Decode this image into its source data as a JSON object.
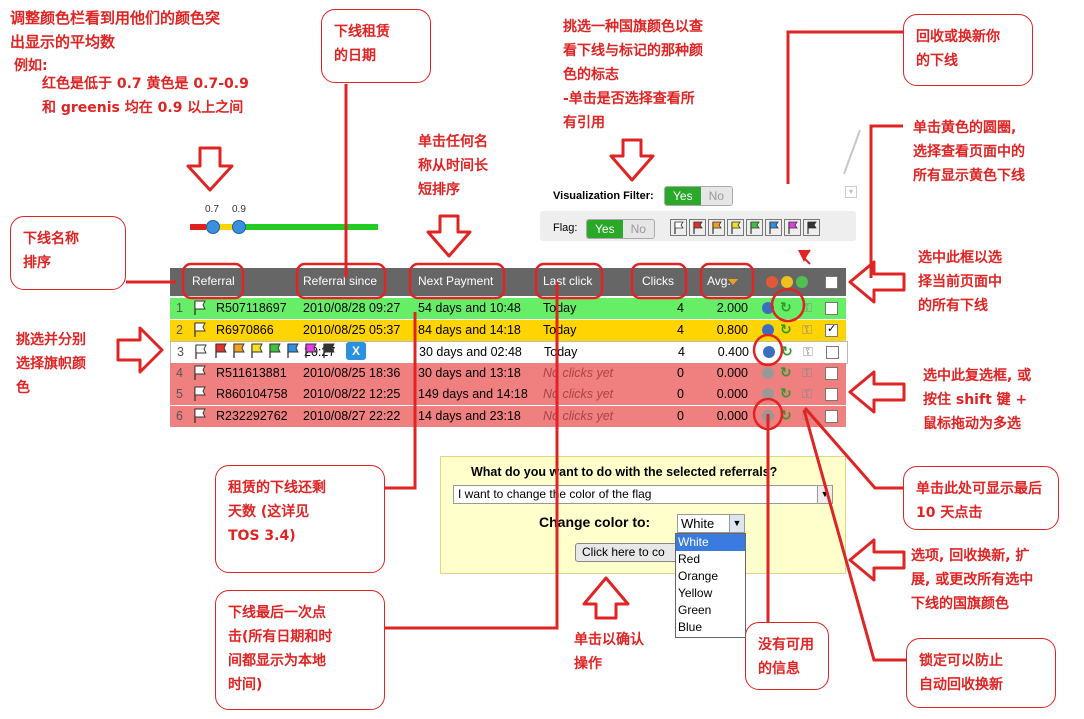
{
  "annotations": {
    "top_left_lines": [
      "调整颜色栏看到用他们的颜色突",
      "出显示的平均数"
    ],
    "example_label": "例如:",
    "example_lines": [
      "红色是低于 0.7 黄色是 0.7-0.9",
      "和 greenis 均在 0.9 以上之间"
    ],
    "rental_date": [
      "下线租赁",
      "的日期"
    ],
    "flag_filter": [
      "挑选一种国旗颜色以查",
      "看下线与标记的那种颜",
      "色的标志",
      "-单击是否选择查看所",
      "有引用"
    ],
    "recycle": [
      "回收或换新你",
      "的下线"
    ],
    "sort_time": [
      "单击任何名",
      "称从时间长",
      "短排序"
    ],
    "yellow_circle": [
      "单击黄色的圆圈,",
      "选择查看页面中的",
      "所有显示黄色下线"
    ],
    "sort_name": [
      "下线名称",
      "排序"
    ],
    "select_all": [
      "选中此框以选",
      "择当前页面中",
      "的所有下线"
    ],
    "pick_flag": [
      "挑选并分别",
      "选择旗帜颜",
      "色"
    ],
    "multi_select": [
      "选中此复选框, 或",
      "按住 shift 键 +",
      "鼠标拖动为多选"
    ],
    "days_left": [
      "租赁的下线还剩",
      "天数 (这详见",
      "TOS 3.4)"
    ],
    "last10": [
      "单击此处可显示最后",
      "10 天点击"
    ],
    "options": [
      "选项, 回收换新, 扩",
      "展, 或更改所有选中",
      "下线的国旗颜色"
    ],
    "last_click": [
      "下线最后一次点",
      "击(所有日期和时",
      "间都显示为本地",
      "时间)"
    ],
    "confirm": [
      "单击以确认",
      "操作"
    ],
    "no_info": [
      "没有可用",
      "的信息"
    ],
    "lock": [
      "锁定可以防止",
      "自动回收换新"
    ]
  },
  "slider": {
    "low": "0.7",
    "high": "0.9"
  },
  "filters": {
    "visualization_label": "Visualization Filter:",
    "flag_label": "Flag:",
    "yes": "Yes",
    "no": "No"
  },
  "table": {
    "headers": [
      "Referral",
      "Referral since",
      "Next Payment",
      "Last click",
      "Clicks",
      "Avg."
    ],
    "rows": [
      {
        "n": "1",
        "ref": "R507118697",
        "since": "2010/08/28 09:27",
        "next": "54 days and 10:48",
        "last": "Today",
        "clicks": "4",
        "avg": "2.000",
        "color": "#66ee66"
      },
      {
        "n": "2",
        "ref": "R6970866",
        "since": "2010/08/25 05:37",
        "next": "84 days and 14:18",
        "last": "Today",
        "clicks": "4",
        "avg": "0.800",
        "color": "#ffd400"
      },
      {
        "n": "3",
        "ref": "",
        "since": "20:27",
        "next": "30 days and 02:48",
        "last": "Today",
        "clicks": "4",
        "avg": "0.400",
        "color": "#ffffff"
      },
      {
        "n": "4",
        "ref": "R511613881",
        "since": "2010/08/25 18:36",
        "next": "30 days and 13:18",
        "last": "No clicks yet",
        "clicks": "0",
        "avg": "0.000",
        "color": "#f07f7f"
      },
      {
        "n": "5",
        "ref": "R860104758",
        "since": "2010/08/22 12:25",
        "next": "149 days and 14:18",
        "last": "No clicks yet",
        "clicks": "0",
        "avg": "0.000",
        "color": "#f07f7f"
      },
      {
        "n": "6",
        "ref": "R232292762",
        "since": "2010/08/27 22:22",
        "next": "14 days and 23:18",
        "last": "No clicks yet",
        "clicks": "0",
        "avg": "0.000",
        "color": "#f07f7f"
      }
    ],
    "flag_x": "X"
  },
  "action": {
    "question": "What do you want to do with the selected referrals?",
    "select_value": "I want to change the color of the flag",
    "change_label": "Change color to:",
    "color_value": "White",
    "button_label": "Click here to co",
    "color_options": [
      "White",
      "Red",
      "Orange",
      "Yellow",
      "Green",
      "Blue"
    ]
  },
  "colors": {
    "accent_red": "#e02424",
    "header_gray": "#666666",
    "green": "#29a829"
  }
}
